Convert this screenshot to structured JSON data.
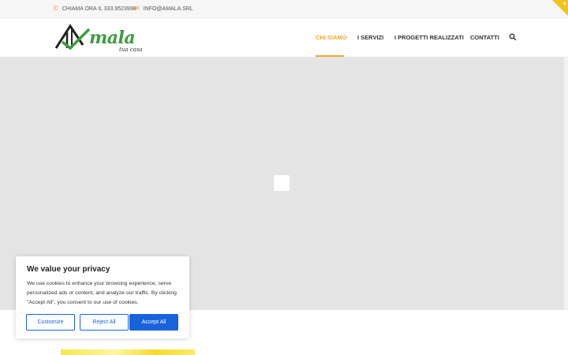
{
  "topbar": {
    "phone_text": "CHIAMA ORA IL 333.9523998",
    "email_text": "INFO@AMALA.SRL"
  },
  "logo": {
    "wordmark": "mala",
    "tagline": "tua casa",
    "brand_color": "#3d9b3f"
  },
  "nav": {
    "items": [
      {
        "label": "CHI SIAMO",
        "active": true
      },
      {
        "label": "I SERVIZI",
        "active": false
      },
      {
        "label": "I PROGETTI REALIZZATI",
        "active": false
      },
      {
        "label": "CONTATTI",
        "active": false
      }
    ],
    "accent_color": "#f0a92e"
  },
  "cookie_banner": {
    "title": "We value your privacy",
    "body": "We use cookies to enhance your browsing experience, serve personalized ads or content, and analyze our traffic. By clicking \"Accept All\", you consent to our use of cookies.",
    "customize_label": "Customize",
    "reject_label": "Reject All",
    "accept_label": "Accept All",
    "button_color": "#1863dc"
  }
}
